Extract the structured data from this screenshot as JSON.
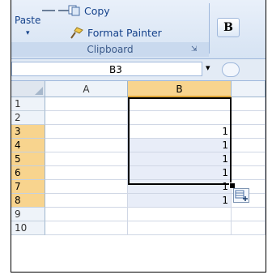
{
  "ribbon": {
    "paste_label": "Paste",
    "paste_dropdown": "▾",
    "copy_label": "Copy",
    "format_painter_label": "Format Painter",
    "bold_label": "B",
    "group_label": "Clipboard",
    "launcher_glyph": "⇲"
  },
  "formula_bar": {
    "name_box_value": "B3",
    "dropdown_glyph": "▾"
  },
  "sheet": {
    "corner": "",
    "columns": [
      {
        "label": "A",
        "selected": false
      },
      {
        "label": "B",
        "selected": true
      }
    ],
    "rows": [
      {
        "label": "1",
        "selected": false,
        "b": ""
      },
      {
        "label": "2",
        "selected": false,
        "b": ""
      },
      {
        "label": "3",
        "selected": true,
        "b": "1"
      },
      {
        "label": "4",
        "selected": true,
        "b": "1"
      },
      {
        "label": "5",
        "selected": true,
        "b": "1"
      },
      {
        "label": "6",
        "selected": true,
        "b": "1"
      },
      {
        "label": "7",
        "selected": true,
        "b": "1"
      },
      {
        "label": "8",
        "selected": true,
        "b": "1"
      },
      {
        "label": "9",
        "selected": false,
        "b": ""
      },
      {
        "label": "10",
        "selected": false,
        "b": ""
      }
    ]
  },
  "colors": {
    "header_selected": "#f8d48e",
    "range_fill": "#e8edf8",
    "ribbon_text": "#15428b"
  }
}
